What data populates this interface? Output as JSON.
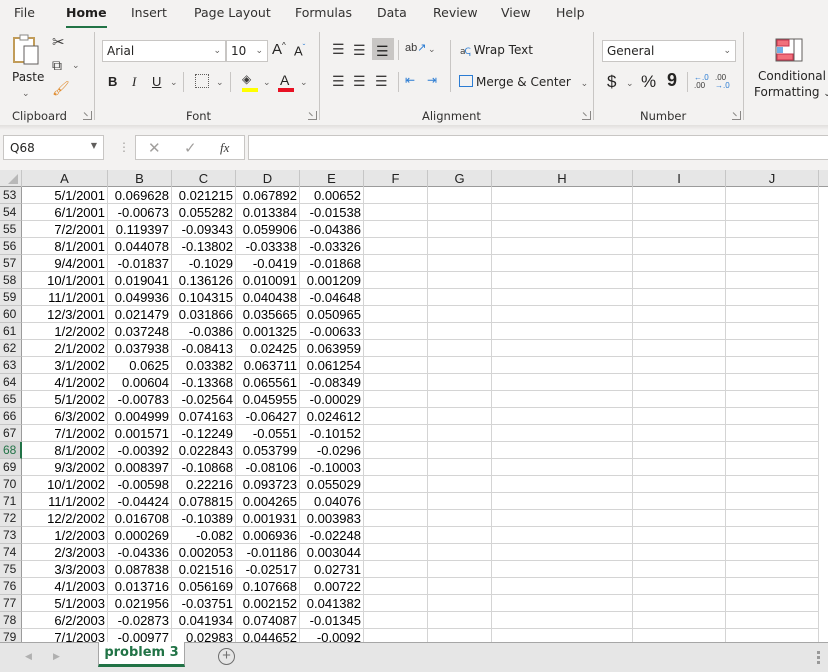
{
  "menu_tabs": [
    {
      "label": "File"
    },
    {
      "label": "Home",
      "active": true
    },
    {
      "label": "Insert"
    },
    {
      "label": "Page Layout"
    },
    {
      "label": "Formulas"
    },
    {
      "label": "Data"
    },
    {
      "label": "Review"
    },
    {
      "label": "View"
    },
    {
      "label": "Help"
    }
  ],
  "ribbon": {
    "clipboard": {
      "paste_label": "Paste",
      "group_label": "Clipboard"
    },
    "font": {
      "font_name": "Arial",
      "font_size": "10",
      "group_label": "Font",
      "bold": "B",
      "italic": "I",
      "underline": "U",
      "grow": "A",
      "shrink": "A",
      "font_color_letter": "A",
      "highlight_color": "#ffff00",
      "font_color": "#e81123"
    },
    "alignment": {
      "wrap_text": "Wrap Text",
      "merge_center": "Merge & Center",
      "group_label": "Alignment",
      "wrap_icon_text": "ab"
    },
    "number": {
      "format": "General",
      "currency": "$",
      "percent": "%",
      "comma": "9",
      "group_label": "Number"
    },
    "styles": {
      "conditional_formatting_line1": "Conditional",
      "conditional_formatting_line2": "Formatting"
    }
  },
  "formula_bar": {
    "name_box": "Q68",
    "fx_label": "fx",
    "formula": ""
  },
  "columns": [
    "A",
    "B",
    "C",
    "D",
    "E",
    "F",
    "G",
    "H",
    "I",
    "J"
  ],
  "selected_row": "68",
  "rows": [
    {
      "num": "53",
      "cells": [
        "5/1/2001",
        "0.069628",
        "0.021215",
        "0.067892",
        "0.00652"
      ]
    },
    {
      "num": "54",
      "cells": [
        "6/1/2001",
        "-0.00673",
        "0.055282",
        "0.013384",
        "-0.01538"
      ]
    },
    {
      "num": "55",
      "cells": [
        "7/2/2001",
        "0.119397",
        "-0.09343",
        "0.059906",
        "-0.04386"
      ]
    },
    {
      "num": "56",
      "cells": [
        "8/1/2001",
        "0.044078",
        "-0.13802",
        "-0.03338",
        "-0.03326"
      ]
    },
    {
      "num": "57",
      "cells": [
        "9/4/2001",
        "-0.01837",
        "-0.1029",
        "-0.0419",
        "-0.01868"
      ]
    },
    {
      "num": "58",
      "cells": [
        "10/1/2001",
        "0.019041",
        "0.136126",
        "0.010091",
        "0.001209"
      ]
    },
    {
      "num": "59",
      "cells": [
        "11/1/2001",
        "0.049936",
        "0.104315",
        "0.040438",
        "-0.04648"
      ]
    },
    {
      "num": "60",
      "cells": [
        "12/3/2001",
        "0.021479",
        "0.031866",
        "0.035665",
        "0.050965"
      ]
    },
    {
      "num": "61",
      "cells": [
        "1/2/2002",
        "0.037248",
        "-0.0386",
        "0.001325",
        "-0.00633"
      ]
    },
    {
      "num": "62",
      "cells": [
        "2/1/2002",
        "0.037938",
        "-0.08413",
        "0.02425",
        "0.063959"
      ]
    },
    {
      "num": "63",
      "cells": [
        "3/1/2002",
        "0.0625",
        "0.03382",
        "0.063711",
        "0.061254"
      ]
    },
    {
      "num": "64",
      "cells": [
        "4/1/2002",
        "0.00604",
        "-0.13368",
        "0.065561",
        "-0.08349"
      ]
    },
    {
      "num": "65",
      "cells": [
        "5/1/2002",
        "-0.00783",
        "-0.02564",
        "0.045955",
        "-0.00029"
      ]
    },
    {
      "num": "66",
      "cells": [
        "6/3/2002",
        "0.004999",
        "0.074163",
        "-0.06427",
        "0.024612"
      ]
    },
    {
      "num": "67",
      "cells": [
        "7/1/2002",
        "0.001571",
        "-0.12249",
        "-0.0551",
        "-0.10152"
      ]
    },
    {
      "num": "68",
      "cells": [
        "8/1/2002",
        "-0.00392",
        "0.022843",
        "0.053799",
        "-0.0296"
      ]
    },
    {
      "num": "69",
      "cells": [
        "9/3/2002",
        "0.008397",
        "-0.10868",
        "-0.08106",
        "-0.10003"
      ]
    },
    {
      "num": "70",
      "cells": [
        "10/1/2002",
        "-0.00598",
        "0.22216",
        "0.093723",
        "0.055029"
      ]
    },
    {
      "num": "71",
      "cells": [
        "11/1/2002",
        "-0.04424",
        "0.078815",
        "0.004265",
        "0.04076"
      ]
    },
    {
      "num": "72",
      "cells": [
        "12/2/2002",
        "0.016708",
        "-0.10389",
        "0.001931",
        "0.003983"
      ]
    },
    {
      "num": "73",
      "cells": [
        "1/2/2003",
        "0.000269",
        "-0.082",
        "0.006936",
        "-0.02248"
      ]
    },
    {
      "num": "74",
      "cells": [
        "2/3/2003",
        "-0.04336",
        "0.002053",
        "-0.01186",
        "0.003044"
      ]
    },
    {
      "num": "75",
      "cells": [
        "3/3/2003",
        "0.087838",
        "0.021516",
        "-0.02517",
        "0.02731"
      ]
    },
    {
      "num": "76",
      "cells": [
        "4/1/2003",
        "0.013716",
        "0.056169",
        "0.107668",
        "0.00722"
      ]
    },
    {
      "num": "77",
      "cells": [
        "5/1/2003",
        "0.021956",
        "-0.03751",
        "0.002152",
        "0.041382"
      ]
    },
    {
      "num": "78",
      "cells": [
        "6/2/2003",
        "-0.02873",
        "0.041934",
        "0.074087",
        "-0.01345"
      ]
    },
    {
      "num": "79",
      "cells": [
        "7/1/2003",
        "-0.00977",
        "0.02983",
        "0.044652",
        "-0.0092"
      ]
    }
  ],
  "sheet_tabs": [
    {
      "label": "problem 3",
      "active": true
    }
  ],
  "add_sheet_label": "+"
}
